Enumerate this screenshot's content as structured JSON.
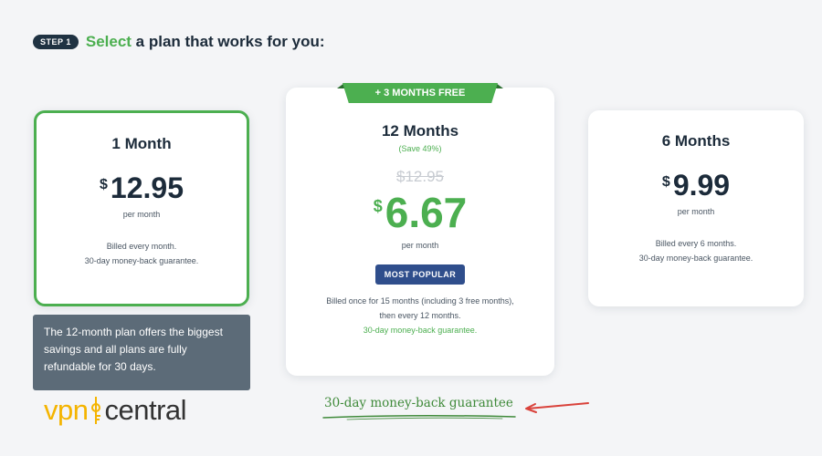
{
  "header": {
    "step_label": "STEP 1",
    "title_accent": "Select",
    "title_rest": " a plan that works for you:"
  },
  "plans": {
    "monthly": {
      "name": "1 Month",
      "currency": "$",
      "price": "12.95",
      "per": "per month",
      "billing_line1": "Billed every month.",
      "billing_line2": "30-day money-back guarantee.",
      "selected": true
    },
    "yearly": {
      "ribbon": "+ 3 MONTHS FREE",
      "name": "12 Months",
      "save": "(Save 49%)",
      "old_price": "$12.95",
      "currency": "$",
      "price": "6.67",
      "per": "per month",
      "badge": "MOST POPULAR",
      "billing_line1": "Billed once for 15 months (including 3 free months),",
      "billing_line2": "then every 12 months.",
      "billing_line3": "30-day money-back guarantee."
    },
    "halfyear": {
      "name": "6 Months",
      "currency": "$",
      "price": "9.99",
      "per": "per month",
      "billing_line1": "Billed every 6 months.",
      "billing_line2": "30-day money-back guarantee."
    }
  },
  "info_box": {
    "text": "The 12-month plan offers the biggest savings and all plans are fully refundable for 30 days."
  },
  "logo": {
    "part1": "vpn",
    "part2": "central"
  },
  "annotation": {
    "text": "30-day money-back guarantee"
  },
  "colors": {
    "accent_green": "#4caf50",
    "navy": "#1f3242",
    "badge_blue": "#2f4e8c",
    "info_gray": "#5c6b78",
    "arrow_red": "#d9423b",
    "logo_yellow": "#f4b400"
  }
}
